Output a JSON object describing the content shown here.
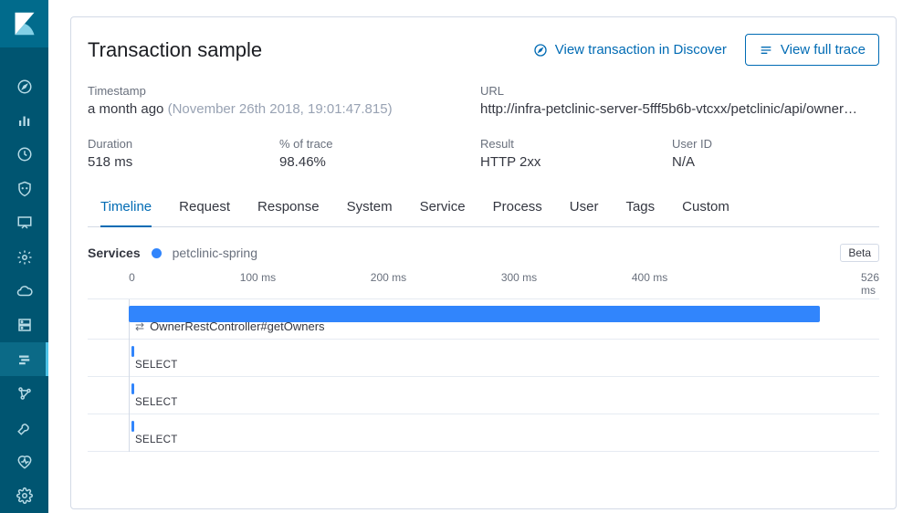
{
  "sidebar": {
    "items": [
      {
        "name": "compass-icon"
      },
      {
        "name": "bar-chart-icon"
      },
      {
        "name": "clock-icon"
      },
      {
        "name": "shield-icon"
      },
      {
        "name": "presentation-icon"
      },
      {
        "name": "gear-ring-icon"
      },
      {
        "name": "cloud-icon"
      },
      {
        "name": "server-icon"
      },
      {
        "name": "apm-icon"
      },
      {
        "name": "graph-icon"
      },
      {
        "name": "wrench-icon"
      },
      {
        "name": "heartbeat-icon"
      },
      {
        "name": "settings-icon"
      }
    ],
    "activeIndex": 8
  },
  "header": {
    "title": "Transaction sample",
    "discover_link": "View transaction in Discover",
    "full_trace_btn": "View full trace"
  },
  "meta": {
    "timestamp_label": "Timestamp",
    "timestamp_value": "a month ago",
    "timestamp_detail": "(November 26th 2018, 19:01:47.815)",
    "url_label": "URL",
    "url_value": "http://infra-petclinic-server-5fff5b6b-vtcxx/petclinic/api/owner…",
    "duration_label": "Duration",
    "duration_value": "518 ms",
    "pct_label": "% of trace",
    "pct_value": "98.46%",
    "result_label": "Result",
    "result_value": "HTTP 2xx",
    "userid_label": "User ID",
    "userid_value": "N/A"
  },
  "tabs": [
    "Timeline",
    "Request",
    "Response",
    "System",
    "Service",
    "Process",
    "User",
    "Tags",
    "Custom"
  ],
  "activeTab": 0,
  "services": {
    "label": "Services",
    "name": "petclinic-spring",
    "color": "#3185fc",
    "beta": "Beta"
  },
  "axis": {
    "ticks": [
      "0",
      "100 ms",
      "200 ms",
      "300 ms",
      "400 ms",
      "526 ms"
    ],
    "positions_pct": [
      5.2,
      21.5,
      38,
      54.5,
      71,
      100
    ]
  },
  "waterfall": {
    "rows": [
      {
        "label": "OwnerRestController#getOwners",
        "type": "transaction",
        "left_pct": 5.2,
        "width_pct": 87.3,
        "indent": 1,
        "icon": true
      },
      {
        "label": "SELECT",
        "type": "db",
        "left_pct": 5.5,
        "width_pct": 0.4,
        "indent": 2
      },
      {
        "label": "SELECT",
        "type": "db",
        "left_pct": 5.5,
        "width_pct": 0.4,
        "indent": 2
      },
      {
        "label": "SELECT",
        "type": "db",
        "left_pct": 5.5,
        "width_pct": 0.4,
        "indent": 2
      }
    ]
  }
}
